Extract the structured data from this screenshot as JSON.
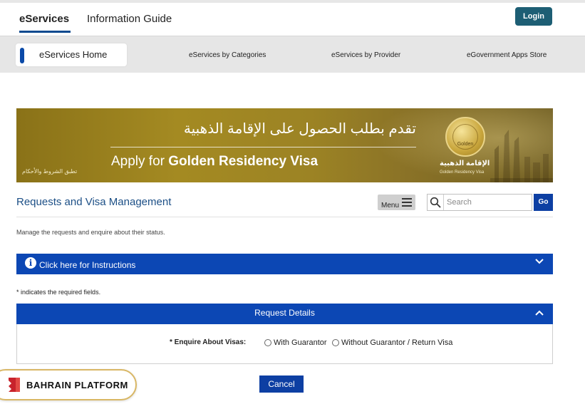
{
  "header": {
    "tabs": [
      {
        "label": "eServices",
        "active": true
      },
      {
        "label": "Information Guide",
        "active": false
      }
    ],
    "login_label": "Login"
  },
  "subnav": {
    "home_label": "eServices Home",
    "links": [
      "eServices by Categories",
      "eServices by Provider",
      "eGovernment Apps Store"
    ]
  },
  "banner": {
    "arabic_headline": "تقدم بطلب الحصول على الإقامة الذهبية",
    "english_prefix": "Apply for ",
    "english_bold": "Golden Residency Visa",
    "terms": "تطبق الشروط والأحكام",
    "seal_text": "Golden",
    "logo_ar": "الإقامة الذهبية",
    "logo_en": "Golden Residency Visa"
  },
  "section": {
    "title": "Requests and Visa Management",
    "menu_label": "Menu",
    "search_placeholder": "Search",
    "go_label": "Go",
    "description": "Manage the requests and enquire about their status."
  },
  "instructions": {
    "label": "Click here for Instructions",
    "icon": "info-icon"
  },
  "form": {
    "required_note": "* indicates the required fields.",
    "details_title": "Request Details",
    "field_label": "* Enquire About Visas:",
    "options": [
      {
        "label": "With Guarantor",
        "selected": false
      },
      {
        "label": "Without Guarantor / Return Visa",
        "selected": false
      }
    ],
    "cancel_label": "Cancel"
  },
  "overlay": {
    "brand_label": "BAHRAIN PLATFORM"
  },
  "colors": {
    "primary_blue": "#0c47b4",
    "login_teal": "#1d5e74",
    "title_blue": "#1c4f86",
    "gold": "#d9b765"
  }
}
